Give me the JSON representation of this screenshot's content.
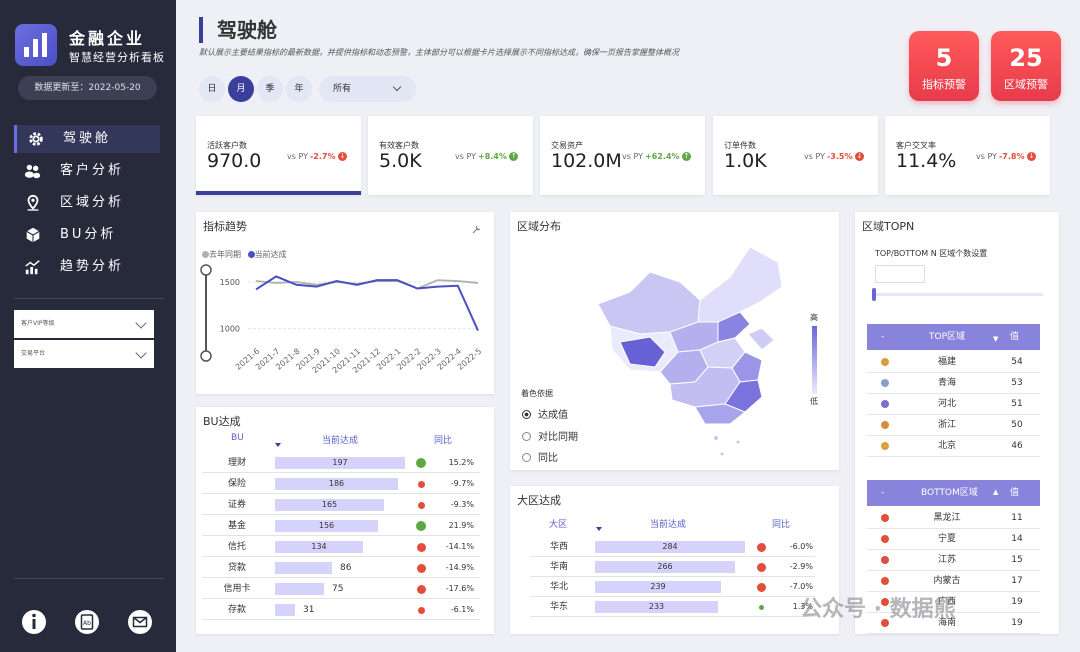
{
  "sidebar": {
    "brand_title": "金融企业",
    "brand_subtitle": "智慧经营分析看板",
    "update_date": "数据更新至：2022-05-20",
    "nav": [
      {
        "label": "驾驶舱",
        "icon": "gear-icon"
      },
      {
        "label": "客户分析",
        "icon": "users-icon"
      },
      {
        "label": "区域分析",
        "icon": "location-pin-icon"
      },
      {
        "label": "BU分析",
        "icon": "cube-icon"
      },
      {
        "label": "趋势分析",
        "icon": "trend-chart-icon"
      }
    ],
    "filters": [
      {
        "value": "客户VIP等级"
      },
      {
        "value": "交易平台"
      }
    ],
    "footer_icons": [
      "info-icon",
      "app-icon",
      "mail-icon"
    ]
  },
  "header": {
    "title": "驾驶舱",
    "description": "默认展示主要结果指标的最新数据，并提供指标和动态预警，主体部分可以根据卡片选择展示不同指标达成，确保一页报告掌握整体概况",
    "periods": [
      "日",
      "月",
      "季",
      "年"
    ],
    "active_period": "月",
    "scope_value": "所有"
  },
  "alerts": [
    {
      "value": "5",
      "label": "指标预警"
    },
    {
      "value": "25",
      "label": "区域预警"
    }
  ],
  "kpis": [
    {
      "title": "活跃客户数",
      "value": "970.0",
      "py_label": "vs PY",
      "change": "-2.7%",
      "trend": "down"
    },
    {
      "title": "有效客户数",
      "value": "5.0K",
      "py_label": "vs PY",
      "change": "+8.4%",
      "trend": "up"
    },
    {
      "title": "交易资产",
      "value": "102.0M",
      "py_label": "vs PY",
      "change": "+62.4%",
      "trend": "up"
    },
    {
      "title": "订单件数",
      "value": "1.0K",
      "py_label": "vs PY",
      "change": "-3.5%",
      "trend": "down"
    },
    {
      "title": "客户交叉率",
      "value": "11.4%",
      "py_label": "vs PY",
      "change": "-7.8%",
      "trend": "down"
    }
  ],
  "trend": {
    "title": "指标趋势",
    "legend": [
      "去年同期",
      "当前达成"
    ],
    "colors": [
      "#b0b0b0",
      "#4a4fc4"
    ]
  },
  "chart_data": {
    "type": "line",
    "x": [
      "2021-6",
      "2021-7",
      "2021-8",
      "2021-9",
      "2021-10",
      "2021-11",
      "2021-12",
      "2022-1",
      "2022-2",
      "2022-3",
      "2022-4",
      "2022-5"
    ],
    "series": [
      {
        "name": "去年同期",
        "values": [
          1510,
          1490,
          1500,
          1470,
          1500,
          1480,
          1510,
          1510,
          1430,
          1520,
          1510,
          1490
        ]
      },
      {
        "name": "当前达成",
        "values": [
          1420,
          1560,
          1470,
          1450,
          1510,
          1470,
          1520,
          1520,
          1430,
          1450,
          1460,
          980
        ]
      }
    ],
    "yticks": [
      "1500",
      "1000"
    ],
    "ylim": [
      900,
      1650
    ]
  },
  "bu": {
    "title": "BU达成",
    "headers": [
      "BU",
      "当前达成",
      "同比"
    ],
    "max": 197,
    "rows": [
      {
        "name": "理财",
        "value": "197",
        "yoy": "15.2%",
        "pos": true
      },
      {
        "name": "保险",
        "value": "186",
        "yoy": "-9.7%",
        "pos": false
      },
      {
        "name": "证券",
        "value": "165",
        "yoy": "-9.3%",
        "pos": false
      },
      {
        "name": "基金",
        "value": "156",
        "yoy": "21.9%",
        "pos": true
      },
      {
        "name": "信托",
        "value": "134",
        "yoy": "-14.1%",
        "pos": false
      },
      {
        "name": "贷款",
        "value": "86",
        "yoy": "-14.9%",
        "pos": false
      },
      {
        "name": "信用卡",
        "value": "75",
        "yoy": "-17.6%",
        "pos": false
      },
      {
        "name": "存款",
        "value": "31",
        "yoy": "-6.1%",
        "pos": false
      }
    ]
  },
  "map": {
    "title": "区域分布",
    "legend_high": "高",
    "legend_low": "低",
    "color_by_title": "着色依据",
    "options": [
      "达成值",
      "对比同期",
      "同比"
    ],
    "selected": "达成值"
  },
  "region": {
    "title": "大区达成",
    "headers": [
      "大区",
      "当前达成",
      "同比"
    ],
    "max": 284,
    "rows": [
      {
        "name": "华西",
        "value": "284",
        "yoy": "-6.0%"
      },
      {
        "name": "华南",
        "value": "266",
        "yoy": "-2.9%"
      },
      {
        "name": "华北",
        "value": "239",
        "yoy": "-7.0%"
      },
      {
        "name": "华东",
        "value": "233",
        "yoy": "1.3%"
      }
    ]
  },
  "topn": {
    "title": "区域TOPN",
    "setting_label": "TOP/BOTTOM N 区域个数设置",
    "top_headers": [
      "-",
      "TOP区域",
      "值"
    ],
    "bottom_headers": [
      "-",
      "BOTTOM区域",
      "值"
    ],
    "top_rows": [
      {
        "name": "福建",
        "value": "54"
      },
      {
        "name": "青海",
        "value": "53"
      },
      {
        "name": "河北",
        "value": "51"
      },
      {
        "name": "浙江",
        "value": "50"
      },
      {
        "name": "北京",
        "value": "46"
      }
    ],
    "bottom_rows": [
      {
        "name": "黑龙江",
        "value": "11"
      },
      {
        "name": "宁夏",
        "value": "14"
      },
      {
        "name": "江苏",
        "value": "15"
      },
      {
        "name": "内蒙古",
        "value": "17"
      },
      {
        "name": "广西",
        "value": "19"
      },
      {
        "name": "海南",
        "value": "19"
      }
    ]
  },
  "watermark": "公众号 · 数据熊"
}
